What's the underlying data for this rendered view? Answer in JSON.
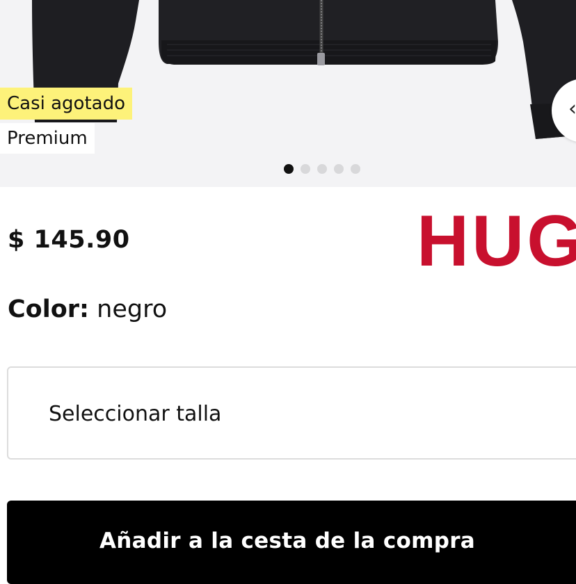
{
  "gallery": {
    "badges": [
      "Casi agotado",
      "Premium"
    ],
    "dots_total": 5,
    "active_dot": 1,
    "next_icon": "chevron-right-icon"
  },
  "product": {
    "price": "$ 145.90",
    "brand": "HUG",
    "color_label": "Color:",
    "color_value": "negro"
  },
  "size_select": {
    "placeholder": "Seleccionar talla"
  },
  "cart_button": {
    "label": "Añadir a la cesta de la compra"
  },
  "colors": {
    "brand_red": "#c8102e",
    "badge_yellow": "#fdf27a",
    "button_black": "#000000"
  }
}
